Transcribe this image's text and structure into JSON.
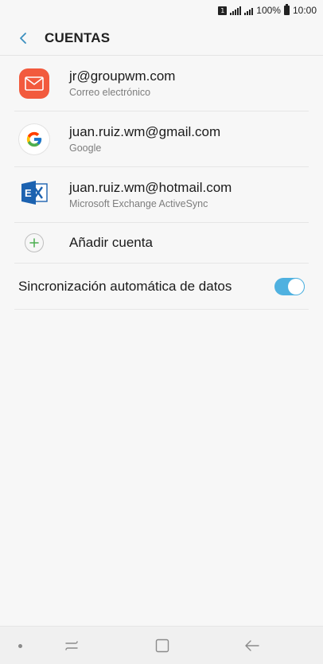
{
  "status_bar": {
    "sim_slot": "1",
    "battery": "100%",
    "time": "10:00"
  },
  "header": {
    "title": "CUENTAS",
    "back_icon": "back-arrow-icon"
  },
  "accounts": [
    {
      "name": "jr@groupwm.com",
      "type": "Correo electrónico",
      "icon": "email-icon",
      "icon_color": "#f25a3d"
    },
    {
      "name": "juan.ruiz.wm@gmail.com",
      "type": "Google",
      "icon": "google-icon"
    },
    {
      "name": "juan.ruiz.wm@hotmail.com",
      "type": "Microsoft Exchange ActiveSync",
      "icon": "exchange-icon",
      "icon_color": "#1c62b0"
    }
  ],
  "add_account": {
    "label": "Añadir cuenta",
    "icon": "plus-icon",
    "icon_color": "#4caf50"
  },
  "sync": {
    "label": "Sincronización automática de datos",
    "enabled": true,
    "accent": "#4fb1e0"
  },
  "nav_bar": {
    "buttons": [
      "recent-apps-icon",
      "home-icon",
      "back-icon"
    ]
  }
}
